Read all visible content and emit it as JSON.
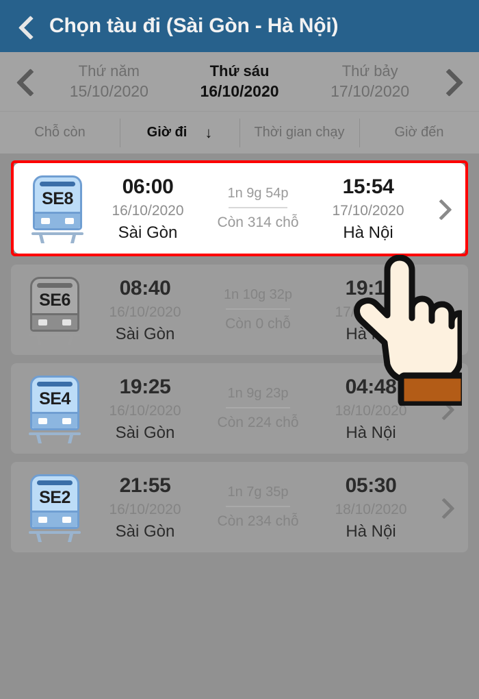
{
  "header": {
    "back_icon": "chevron-left-icon",
    "title": "Chọn tàu đi (Sài Gòn - Hà Nội)",
    "bg_color": "#27618c"
  },
  "date_nav": {
    "prev_icon": "chevron-left-icon",
    "next_icon": "chevron-right-icon",
    "dates": [
      {
        "dow": "Thứ năm",
        "dmy": "15/10/2020",
        "active": false
      },
      {
        "dow": "Thứ sáu",
        "dmy": "16/10/2020",
        "active": true
      },
      {
        "dow": "Thứ bảy",
        "dmy": "17/10/2020",
        "active": false
      }
    ]
  },
  "filters": [
    {
      "label": "Chỗ còn",
      "active": false,
      "sort_icon": ""
    },
    {
      "label": "Giờ đi",
      "active": true,
      "sort_icon": "↓"
    },
    {
      "label": "Thời gian chạy",
      "active": false,
      "sort_icon": ""
    },
    {
      "label": "Giờ đến",
      "active": false,
      "sort_icon": ""
    }
  ],
  "trains": [
    {
      "code": "SE8",
      "depart_time": "06:00",
      "depart_date": "16/10/2020",
      "depart_station": "Sài Gòn",
      "duration": "1n 9g 54p",
      "seats": "Còn 314 chỗ",
      "arrive_time": "15:54",
      "arrive_date": "17/10/2020",
      "arrive_station": "Hà Nội",
      "chevron_icon": "chevron-right-icon"
    },
    {
      "code": "SE6",
      "depart_time": "08:40",
      "depart_date": "16/10/2020",
      "depart_station": "Sài Gòn",
      "duration": "1n 10g 32p",
      "seats": "Còn 0 chỗ",
      "arrive_time": "19:12",
      "arrive_date": "17/10/2020",
      "arrive_station": "Hà Nội",
      "chevron_icon": "chevron-right-icon"
    },
    {
      "code": "SE4",
      "depart_time": "19:25",
      "depart_date": "16/10/2020",
      "depart_station": "Sài Gòn",
      "duration": "1n 9g 23p",
      "seats": "Còn 224 chỗ",
      "arrive_time": "04:48",
      "arrive_date": "18/10/2020",
      "arrive_station": "Hà Nội",
      "chevron_icon": "chevron-right-icon"
    },
    {
      "code": "SE2",
      "depart_time": "21:55",
      "depart_date": "16/10/2020",
      "depart_station": "Sài Gòn",
      "duration": "1n 7g 35p",
      "seats": "Còn 234 chỗ",
      "arrive_time": "05:30",
      "arrive_date": "18/10/2020",
      "arrive_station": "Hà Nội",
      "chevron_icon": "chevron-right-icon"
    }
  ],
  "annotation": {
    "highlight_color": "#ff0000",
    "cursor_icon": "pointing-hand-cursor"
  }
}
